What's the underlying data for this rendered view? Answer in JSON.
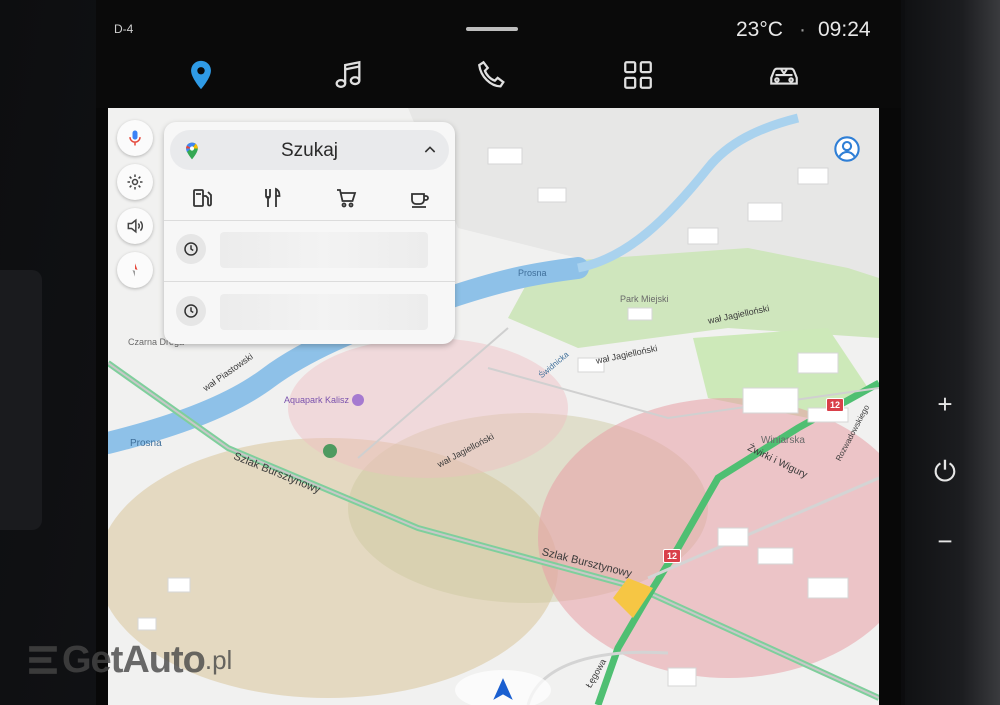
{
  "status_bar": {
    "left_glyph": "D-4",
    "temperature": "23°C",
    "separator": "·",
    "time": "09:24"
  },
  "tabs": [
    {
      "name": "navigation",
      "icon": "location-pin-icon",
      "active": true
    },
    {
      "name": "music",
      "icon": "music-note-icon",
      "active": false
    },
    {
      "name": "phone",
      "icon": "phone-icon",
      "active": false
    },
    {
      "name": "apps",
      "icon": "apps-grid-icon",
      "active": false
    },
    {
      "name": "vehicle",
      "icon": "car-icon",
      "active": false
    }
  ],
  "map_controls": [
    "microphone-icon",
    "gear-icon",
    "speaker-icon",
    "compass-icon"
  ],
  "search_panel": {
    "search_label": "Szukaj",
    "categories": [
      "fuel-pump-icon",
      "restaurant-icon",
      "shopping-cart-icon",
      "coffee-cup-icon"
    ],
    "recent_count": 2
  },
  "map_labels": {
    "park": "Park Miejski",
    "river_left": "Prosna",
    "river_mid": "Prosna",
    "czarna": "Czarna Droga",
    "piastowski": "wał Piastowski",
    "aquapark": "Aquapark Kalisz",
    "jagiellonski_1": "wał Jagielloński",
    "jagiellonski_2": "wał Jagielloński",
    "jagiellonski_3": "wał Jagielloński",
    "swiderska": "Świdnicka",
    "szlak_1": "Szlak Bursztynowy",
    "szlak_2": "Szlak Bursztynowy",
    "winiarska": "Winiarska",
    "zwirki": "Żwirki i Wigury",
    "legowa": "Łęgowa",
    "rozwadowskiego": "Rozwadowskiego",
    "shield_1": "12",
    "shield_2": "12"
  },
  "hardware_keys": {
    "plus": "+",
    "power": "⏻",
    "minus": "−"
  },
  "watermark": {
    "brand": "GetAuto",
    "suffix": ".pl"
  },
  "colors": {
    "accent": "#2f9be6",
    "route_green": "#4fbf72",
    "traffic_red": "#e89fa6",
    "water": "#8ec1e8",
    "park": "#cfe8b8"
  }
}
